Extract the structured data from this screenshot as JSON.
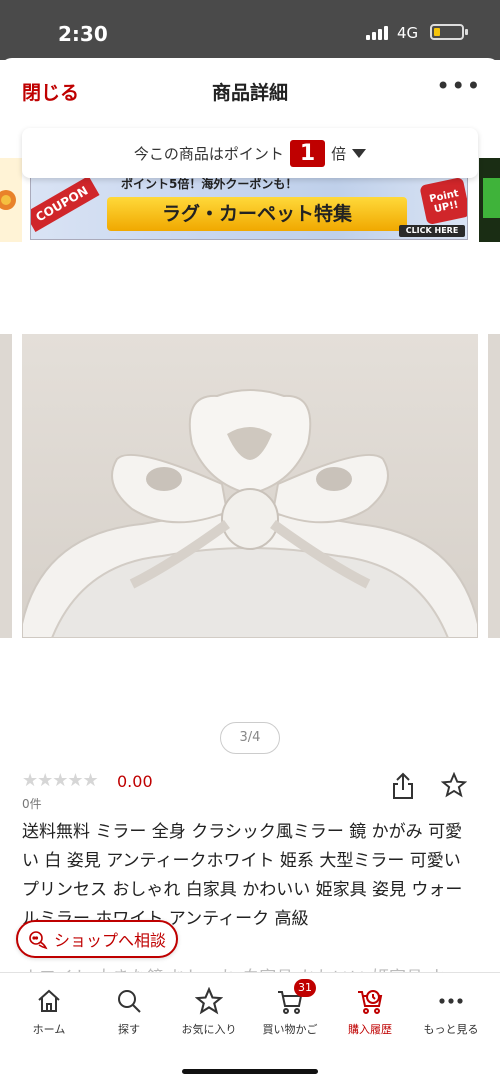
{
  "status": {
    "time": "2:30",
    "network": "4G"
  },
  "nav": {
    "close_label": "閉じる",
    "title": "商品詳細",
    "more_label": "•••"
  },
  "points_banner": {
    "prefix": "今この商品はポイント",
    "multiplier": "1",
    "suffix": "倍"
  },
  "coupon_banner": {
    "tag": "COUPON",
    "top_line": "ポイント5倍！海外クーポンも！",
    "headline": "ラグ・カーペット特集",
    "badge": "Point UP!!",
    "cta": "CLICK HERE"
  },
  "gallery": {
    "pager": "3/4"
  },
  "rating": {
    "stars": "★★★★★",
    "value": "0.00",
    "review_count": "0件"
  },
  "product": {
    "title": "送料無料 ミラー 全身 クラシック風ミラー 鏡 かがみ 可愛い 白 姿見 アンティークホワイト 姫系 大型ミラー 可愛い プリンセス おしゃれ 白家具 かわいい 姫家具 姿見 ウォールミラー ホワイト アンティーク 高級",
    "faded_text": "ホワイト 大きな鏡 おしゃれ 白家具 かわいい 姫家具 ウォールミラー"
  },
  "consult_button": {
    "label": "ショップへ相談"
  },
  "tabbar": {
    "tabs": [
      {
        "label": "ホーム",
        "icon": "home-icon"
      },
      {
        "label": "探す",
        "icon": "search-icon"
      },
      {
        "label": "お気に入り",
        "icon": "star-icon"
      },
      {
        "label": "買い物かご",
        "icon": "cart-icon"
      },
      {
        "label": "購入履歴",
        "icon": "purchase-history-icon"
      },
      {
        "label": "もっと見る",
        "icon": "more-icon"
      }
    ],
    "cart_count": "31"
  },
  "colors": {
    "accent": "#bf0000",
    "status_bar": "#4a4a4a"
  }
}
